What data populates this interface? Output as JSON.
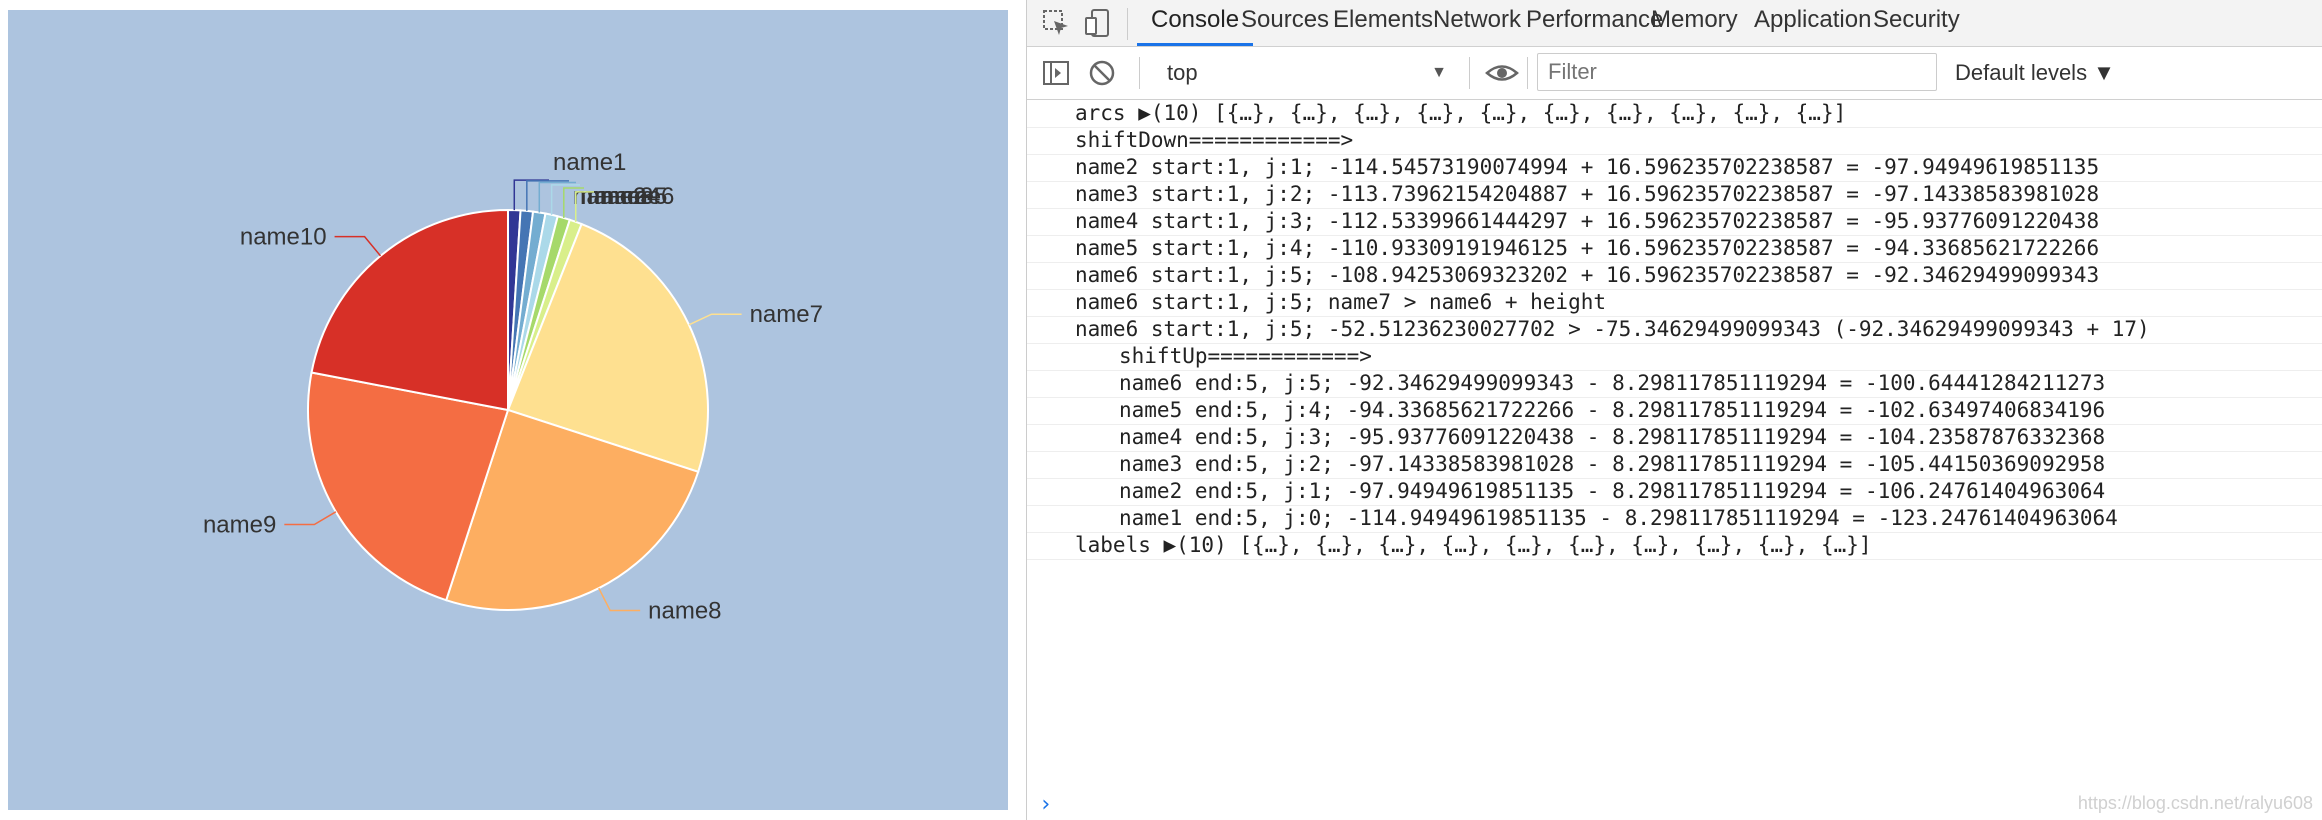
{
  "chart_data": {
    "type": "pie",
    "categories": [
      "name1",
      "name2",
      "name3",
      "name4",
      "name5",
      "name6",
      "name7",
      "name8",
      "name9",
      "name10"
    ],
    "values": [
      1,
      1,
      1,
      1,
      1,
      1,
      24,
      25,
      23,
      22
    ],
    "labels": [
      "name1",
      "name2",
      "name3",
      "name4",
      "name5",
      "name6",
      "name7",
      "name8",
      "name9",
      "name10"
    ],
    "colors": [
      "#313695",
      "#4575b4",
      "#74add1",
      "#abd9e9",
      "#a6d96a",
      "#d9ef8b",
      "#fee090",
      "#fdae61",
      "#f46d43",
      "#d73027"
    ],
    "background": "#adc4df"
  },
  "devtools": {
    "tabs": [
      "Console",
      "Sources",
      "Elements",
      "Network",
      "Performance",
      "Memory",
      "Application",
      "Security"
    ],
    "active_tab": "Console",
    "context": "top",
    "filter_placeholder": "Filter",
    "levels": "Default levels ▼",
    "console_lines": [
      {
        "indent": false,
        "text": "arcs ▶(10) [{…}, {…}, {…}, {…}, {…}, {…}, {…}, {…}, {…}, {…}]"
      },
      {
        "indent": false,
        "text": "shiftDown============>"
      },
      {
        "indent": false,
        "text": "name2 start:1, j:1; -114.54573190074994 + 16.596235702238587 = -97.94949619851135"
      },
      {
        "indent": false,
        "text": "name3 start:1, j:2; -113.73962154204887 + 16.596235702238587 = -97.14338583981028"
      },
      {
        "indent": false,
        "text": "name4 start:1, j:3; -112.53399661444297 + 16.596235702238587 = -95.93776091220438"
      },
      {
        "indent": false,
        "text": "name5 start:1, j:4; -110.93309191946125 + 16.596235702238587 = -94.33685621722266"
      },
      {
        "indent": false,
        "text": "name6 start:1, j:5; -108.94253069323202 + 16.596235702238587 = -92.34629499099343"
      },
      {
        "indent": false,
        "text": "name6 start:1, j:5; name7 > name6 + height"
      },
      {
        "indent": false,
        "text": "name6 start:1, j:5; -52.51236230027702 > -75.34629499099343 (-92.34629499099343 + 17)"
      },
      {
        "indent": true,
        "text": "shiftUp============>"
      },
      {
        "indent": true,
        "text": "name6 end:5, j:5; -92.34629499099343 - 8.298117851119294 = -100.64441284211273"
      },
      {
        "indent": true,
        "text": "name5 end:5, j:4; -94.33685621722266 - 8.298117851119294 = -102.63497406834196"
      },
      {
        "indent": true,
        "text": "name4 end:5, j:3; -95.93776091220438 - 8.298117851119294 = -104.23587876332368"
      },
      {
        "indent": true,
        "text": "name3 end:5, j:2; -97.14338583981028 - 8.298117851119294 = -105.44150369092958"
      },
      {
        "indent": true,
        "text": "name2 end:5, j:1; -97.94949619851135 - 8.298117851119294 = -106.24761404963064"
      },
      {
        "indent": true,
        "text": "name1 end:5, j:0; -114.94949619851135 - 8.298117851119294 = -123.24761404963064"
      },
      {
        "indent": false,
        "text": "labels ▶(10) [{…}, {…}, {…}, {…}, {…}, {…}, {…}, {…}, {…}, {…}]"
      }
    ],
    "prompt": "›",
    "watermark": "https://blog.csdn.net/ralyu608"
  }
}
